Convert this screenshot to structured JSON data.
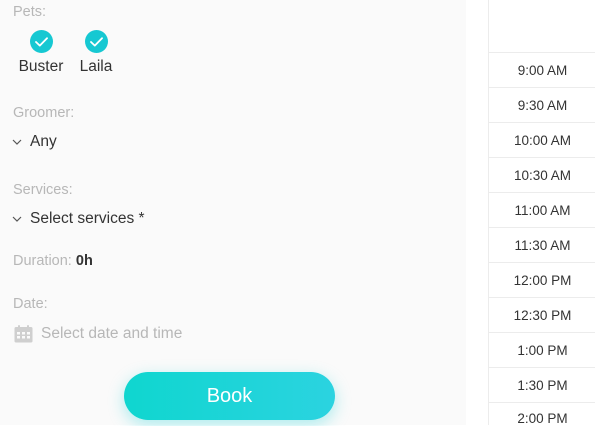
{
  "pets": {
    "label": "Pets:",
    "items": [
      {
        "name": "Buster",
        "selected": true
      },
      {
        "name": "Laila",
        "selected": true
      }
    ]
  },
  "groomer": {
    "label": "Groomer:",
    "value": "Any"
  },
  "services": {
    "label": "Services:",
    "value": "Select services *"
  },
  "duration": {
    "label": "Duration:",
    "value": "0h"
  },
  "date": {
    "label": "Date:",
    "placeholder": "Select date and time"
  },
  "book_button": {
    "label": "Book"
  },
  "time_slots": [
    "9:00 AM",
    "9:30 AM",
    "10:00 AM",
    "10:30 AM",
    "11:00 AM",
    "11:30 AM",
    "12:00 PM",
    "12:30 PM",
    "1:00 PM",
    "1:30 PM",
    "2:00 PM"
  ],
  "colors": {
    "accent": "#16c8d2",
    "label_gray": "#b7b7b7",
    "text": "#333333"
  },
  "icons": {
    "check": "check-icon",
    "chevron": "chevron-down-icon",
    "calendar": "calendar-icon"
  }
}
